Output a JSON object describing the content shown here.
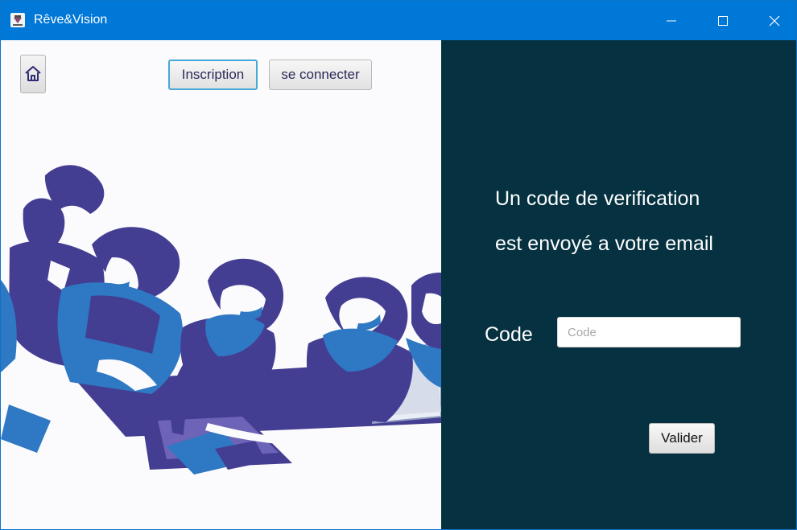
{
  "window": {
    "title": "Rêve&Vision",
    "icons": {
      "app": "app-logo-icon",
      "minimize": "minimize-icon",
      "maximize": "maximize-icon",
      "close": "close-icon",
      "home": "home-icon"
    }
  },
  "nav": {
    "inscription_label": "Inscription",
    "login_label": "se connecter"
  },
  "verification": {
    "message_line_1": "Un code de verification",
    "message_line_2": "est envoyé a votre email",
    "code_label": "Code",
    "code_placeholder": "Code",
    "code_value": "",
    "validate_label": "Valider"
  },
  "colors": {
    "titlebar": "#0078d7",
    "right_panel": "#053140",
    "illustration_primary": "#443e92",
    "illustration_secondary": "#2f78c3"
  }
}
